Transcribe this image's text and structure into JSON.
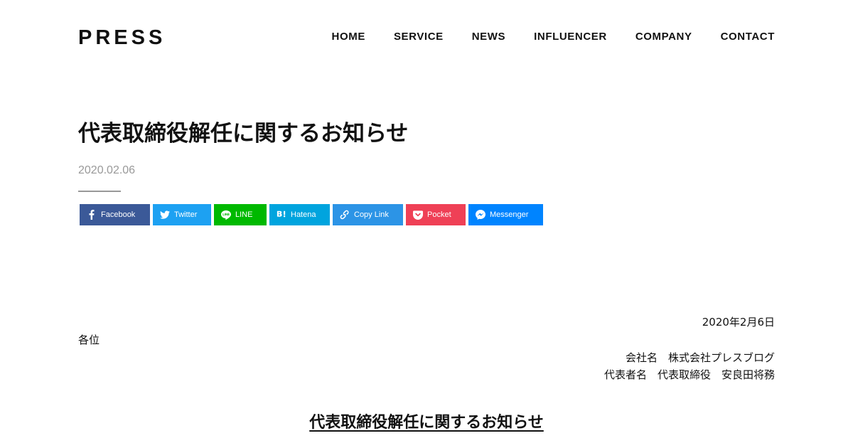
{
  "header": {
    "logo": "PRESS",
    "nav": [
      "HOME",
      "SERVICE",
      "NEWS",
      "INFLUENCER",
      "COMPANY",
      "CONTACT"
    ]
  },
  "article": {
    "title": "代表取締役解任に関するお知らせ",
    "date": "2020.02.06"
  },
  "share": {
    "buttons": [
      {
        "label": "Facebook",
        "icon": "facebook-icon",
        "color": "#3b5998"
      },
      {
        "label": "Twitter",
        "icon": "twitter-icon",
        "color": "#1da1f2"
      },
      {
        "label": "LINE",
        "icon": "line-icon",
        "color": "#00b900"
      },
      {
        "label": "Hatena",
        "icon": "hatena-icon",
        "color": "#00a4de"
      },
      {
        "label": "Copy Link",
        "icon": "link-icon",
        "color": "#2c94e6"
      },
      {
        "label": "Pocket",
        "icon": "pocket-icon",
        "color": "#ef4056"
      },
      {
        "label": "Messenger",
        "icon": "messenger-icon",
        "color": "#0084ff"
      }
    ]
  },
  "letter": {
    "date": "2020年2月6日",
    "to": "各位",
    "company": "会社名　株式会社プレスブログ",
    "representative": "代表者名　代表取締役　安良田将務",
    "heading": "代表取締役解任に関するお知らせ"
  }
}
